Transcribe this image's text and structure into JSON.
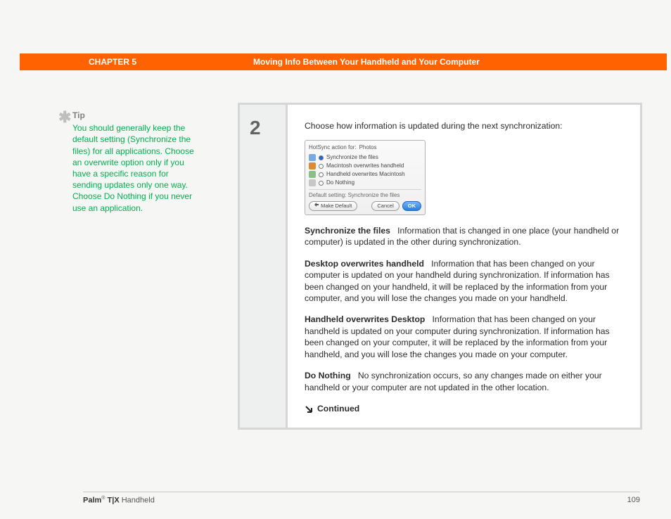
{
  "header": {
    "chapter": "CHAPTER 5",
    "title": "Moving Info Between Your Handheld and Your Computer"
  },
  "tip": {
    "label": "Tip",
    "body": "You should generally keep the default setting (Synchronize the files) for all applications. Choose an overwrite option only if you have a specific reason for sending updates only one way. Choose Do Nothing if you never use an application."
  },
  "step": {
    "number": "2",
    "intro": "Choose how information is updated during the next synchronization:"
  },
  "dialog": {
    "head_label": "HotSync action for:",
    "head_value": "Photos",
    "options": [
      {
        "label": "Synchronize the files",
        "selected": true
      },
      {
        "label": "Macintosh overwrites handheld",
        "selected": false
      },
      {
        "label": "Handheld overwrites Macintosh",
        "selected": false
      },
      {
        "label": "Do Nothing",
        "selected": false
      }
    ],
    "default_line": "Default setting:  Synchronize the files",
    "buttons": {
      "make_default": "Make Default",
      "cancel": "Cancel",
      "ok": "OK"
    }
  },
  "defs": [
    {
      "term": "Synchronize the files",
      "text": "Information that is changed in one place (your handheld or computer) is updated in the other during synchronization."
    },
    {
      "term": "Desktop overwrites handheld",
      "text": "Information that has been changed on your computer is updated on your handheld during synchronization. If information has been changed on your handheld, it will be replaced by the information from your computer, and you will lose the changes you made on your handheld."
    },
    {
      "term": "Handheld overwrites Desktop",
      "text": "Information that has been changed on your handheld is updated on your computer during synchronization. If information has been changed on your computer, it will be replaced by the information from your handheld, and you will lose the changes you made on your computer."
    },
    {
      "term": "Do Nothing",
      "text": "No synchronization occurs, so any changes made on either your handheld or your computer are not updated in the other location."
    }
  ],
  "continued": "Continued",
  "footer": {
    "brand": "Palm",
    "model": "T|X",
    "suffix": " Handheld",
    "page": "109"
  }
}
